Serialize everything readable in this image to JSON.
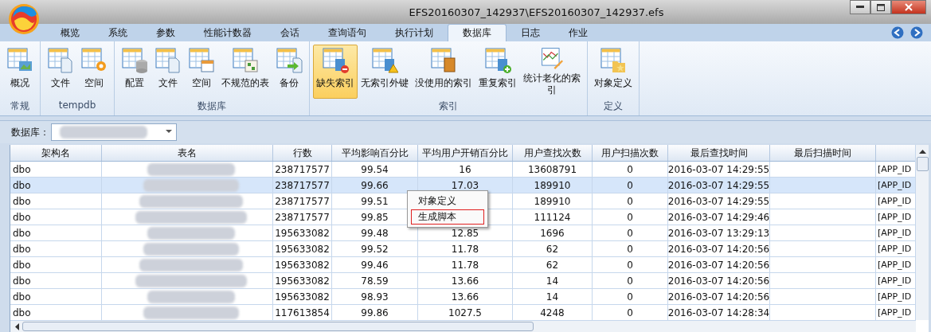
{
  "window": {
    "title": "EFS20160307_142937\\EFS20160307_142937.efs"
  },
  "tabs": [
    {
      "label": "概览",
      "selected": false
    },
    {
      "label": "系统",
      "selected": false
    },
    {
      "label": "参数",
      "selected": false
    },
    {
      "label": "性能计数器",
      "selected": false
    },
    {
      "label": "会话",
      "selected": false
    },
    {
      "label": "查询语句",
      "selected": false
    },
    {
      "label": "执行计划",
      "selected": false
    },
    {
      "label": "数据库",
      "selected": true
    },
    {
      "label": "日志",
      "selected": false
    },
    {
      "label": "作业",
      "selected": false
    }
  ],
  "ribbon_groups": [
    {
      "label": "常规",
      "buttons": [
        {
          "label": "概况",
          "kind": "overview",
          "selected": false
        }
      ]
    },
    {
      "label": "tempdb",
      "buttons": [
        {
          "label": "文件",
          "kind": "file",
          "selected": false
        },
        {
          "label": "空间",
          "kind": "space",
          "selected": false
        }
      ]
    },
    {
      "label": "数据库",
      "buttons": [
        {
          "label": "配置",
          "kind": "database",
          "selected": false
        },
        {
          "label": "文件",
          "kind": "file",
          "selected": false
        },
        {
          "label": "空间",
          "kind": "calendar",
          "selected": false
        },
        {
          "label": "不规范的表",
          "kind": "grid",
          "selected": false
        },
        {
          "label": "备份",
          "kind": "backup",
          "selected": false
        }
      ]
    },
    {
      "label": "索引",
      "buttons": [
        {
          "label": "缺失索引",
          "kind": "minus",
          "selected": true
        },
        {
          "label": "无索引外键",
          "kind": "warning",
          "selected": false
        },
        {
          "label": "没使用的索引",
          "kind": "book",
          "selected": false
        },
        {
          "label": "重复索引",
          "kind": "plus",
          "selected": false
        },
        {
          "label": "统计老化的索引",
          "kind": "chart",
          "selected": false
        }
      ]
    },
    {
      "label": "定义",
      "buttons": [
        {
          "label": "对象定义",
          "kind": "folder",
          "selected": false
        }
      ]
    }
  ],
  "database_filter": {
    "label": "数据库："
  },
  "table": {
    "columns": [
      "架构名",
      "表名",
      "行数",
      "平均影响百分比",
      "平均用户开销百分比",
      "用户查找次数",
      "用户扫描次数",
      "最后查找时间",
      "最后扫描时间"
    ],
    "rows": [
      {
        "schema": "dbo",
        "row_count": "238717577",
        "avg_impact": "99.54",
        "avg_user_cost": "16",
        "user_seeks": "13608791",
        "user_scans": "0",
        "last_seek": "2016-03-07 14:29:55",
        "column_10": "[APP_ID",
        "selected": false
      },
      {
        "schema": "dbo",
        "row_count": "238717577",
        "avg_impact": "99.66",
        "avg_user_cost": "17.03",
        "user_seeks": "189910",
        "user_scans": "0",
        "last_seek": "2016-03-07 14:29:55",
        "column_10": "[APP_ID",
        "selected": true
      },
      {
        "schema": "dbo",
        "row_count": "238717577",
        "avg_impact": "99.51",
        "user_seeks": "189910",
        "user_scans": "0",
        "last_seek": "2016-03-07 14:29:55",
        "column_10": "[APP_ID",
        "selected": false
      },
      {
        "schema": "dbo",
        "row_count": "238717577",
        "avg_impact": "99.85",
        "user_seeks": "111124",
        "user_scans": "0",
        "last_seek": "2016-03-07 14:29:46",
        "column_10": "[APP_ID",
        "selected": false
      },
      {
        "schema": "dbo",
        "row_count": "195633082",
        "avg_impact": "99.48",
        "avg_user_cost": "12.85",
        "user_seeks": "1696",
        "user_scans": "0",
        "last_seek": "2016-03-07 13:29:13",
        "column_10": "[APP_ID",
        "selected": false
      },
      {
        "schema": "dbo",
        "row_count": "195633082",
        "avg_impact": "99.52",
        "avg_user_cost": "11.78",
        "user_seeks": "62",
        "user_scans": "0",
        "last_seek": "2016-03-07 14:20:56",
        "column_10": "[APP_ID",
        "selected": false
      },
      {
        "schema": "dbo",
        "row_count": "195633082",
        "avg_impact": "99.46",
        "avg_user_cost": "11.78",
        "user_seeks": "62",
        "user_scans": "0",
        "last_seek": "2016-03-07 14:20:56",
        "column_10": "[APP_ID",
        "selected": false
      },
      {
        "schema": "dbo",
        "row_count": "195633082",
        "avg_impact": "78.59",
        "avg_user_cost": "13.66",
        "user_seeks": "14",
        "user_scans": "0",
        "last_seek": "2016-03-07 14:20:56",
        "column_10": "[APP_ID",
        "selected": false
      },
      {
        "schema": "dbo",
        "row_count": "195633082",
        "avg_impact": "98.93",
        "avg_user_cost": "13.66",
        "user_seeks": "14",
        "user_scans": "0",
        "last_seek": "2016-03-07 14:20:56",
        "column_10": "[APP_ID",
        "selected": false
      },
      {
        "schema": "dbo",
        "row_count": "117613854",
        "avg_impact": "99.86",
        "avg_user_cost": "1027.5",
        "user_seeks": "4248",
        "user_scans": "0",
        "last_seek": "2016-03-07 14:28:34",
        "column_10": "[APP_ID",
        "selected": false
      }
    ]
  },
  "context_menu": {
    "items": [
      {
        "label": "对象定义",
        "selected": false
      },
      {
        "label": "生成脚本",
        "selected": true
      }
    ]
  }
}
